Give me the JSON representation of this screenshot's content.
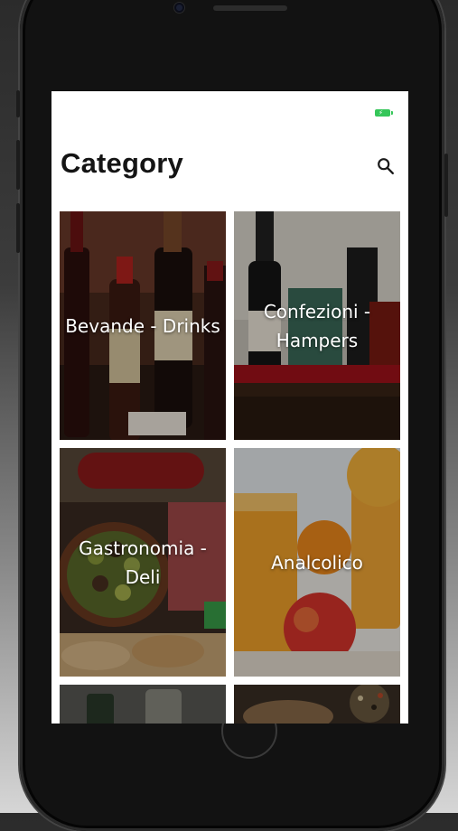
{
  "status_bar": {
    "battery_color": "#35c659"
  },
  "header": {
    "title": "Category",
    "search_icon": "search-icon"
  },
  "categories": [
    {
      "label": "Bevande - Drinks",
      "image": "wine-bottles"
    },
    {
      "label": "Confezioni - Hampers",
      "image": "gift-hamper"
    },
    {
      "label": "Gastronomia - Deli",
      "image": "olives-and-cured-meats"
    },
    {
      "label": "Analcolico",
      "image": "orange-juice-and-apple"
    },
    {
      "label": "",
      "image": "bottle-still-life"
    },
    {
      "label": "",
      "image": "spices-and-food"
    }
  ]
}
